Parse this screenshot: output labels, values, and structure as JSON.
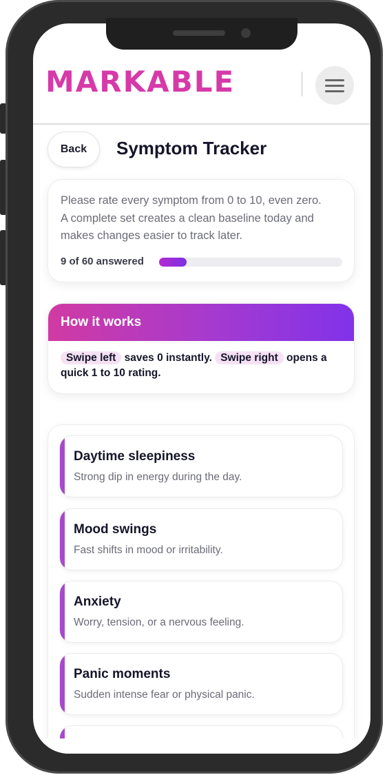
{
  "app": {
    "logo": "MARKABLE"
  },
  "page": {
    "back_label": "Back",
    "title": "Symptom Tracker"
  },
  "intro": {
    "text": "Please rate every symptom from 0 to 10, even zero. A complete set creates a clean baseline today and makes changes easier to track later.",
    "progress_label": "9 of 60 answered",
    "answered": 9,
    "total": 60
  },
  "how_it_works": {
    "title": "How it works",
    "swipe_left": "Swipe left",
    "swipe_left_text": " saves 0 instantly. ",
    "swipe_right": "Swipe right",
    "swipe_right_text": " opens a quick 1 to 10 rating."
  },
  "symptoms": [
    {
      "name": "Daytime sleepiness",
      "desc": "Strong dip in energy during the day."
    },
    {
      "name": "Mood swings",
      "desc": "Fast shifts in mood or irritability."
    },
    {
      "name": "Anxiety",
      "desc": "Worry, tension, or a nervous feeling."
    },
    {
      "name": "Panic moments",
      "desc": "Sudden intense fear or physical panic."
    }
  ],
  "colors": {
    "brand": "#d63aa8",
    "accent": "#a64ac9",
    "gradient_end": "#8132ea"
  },
  "icons": {
    "menu": "hamburger-menu-icon"
  }
}
